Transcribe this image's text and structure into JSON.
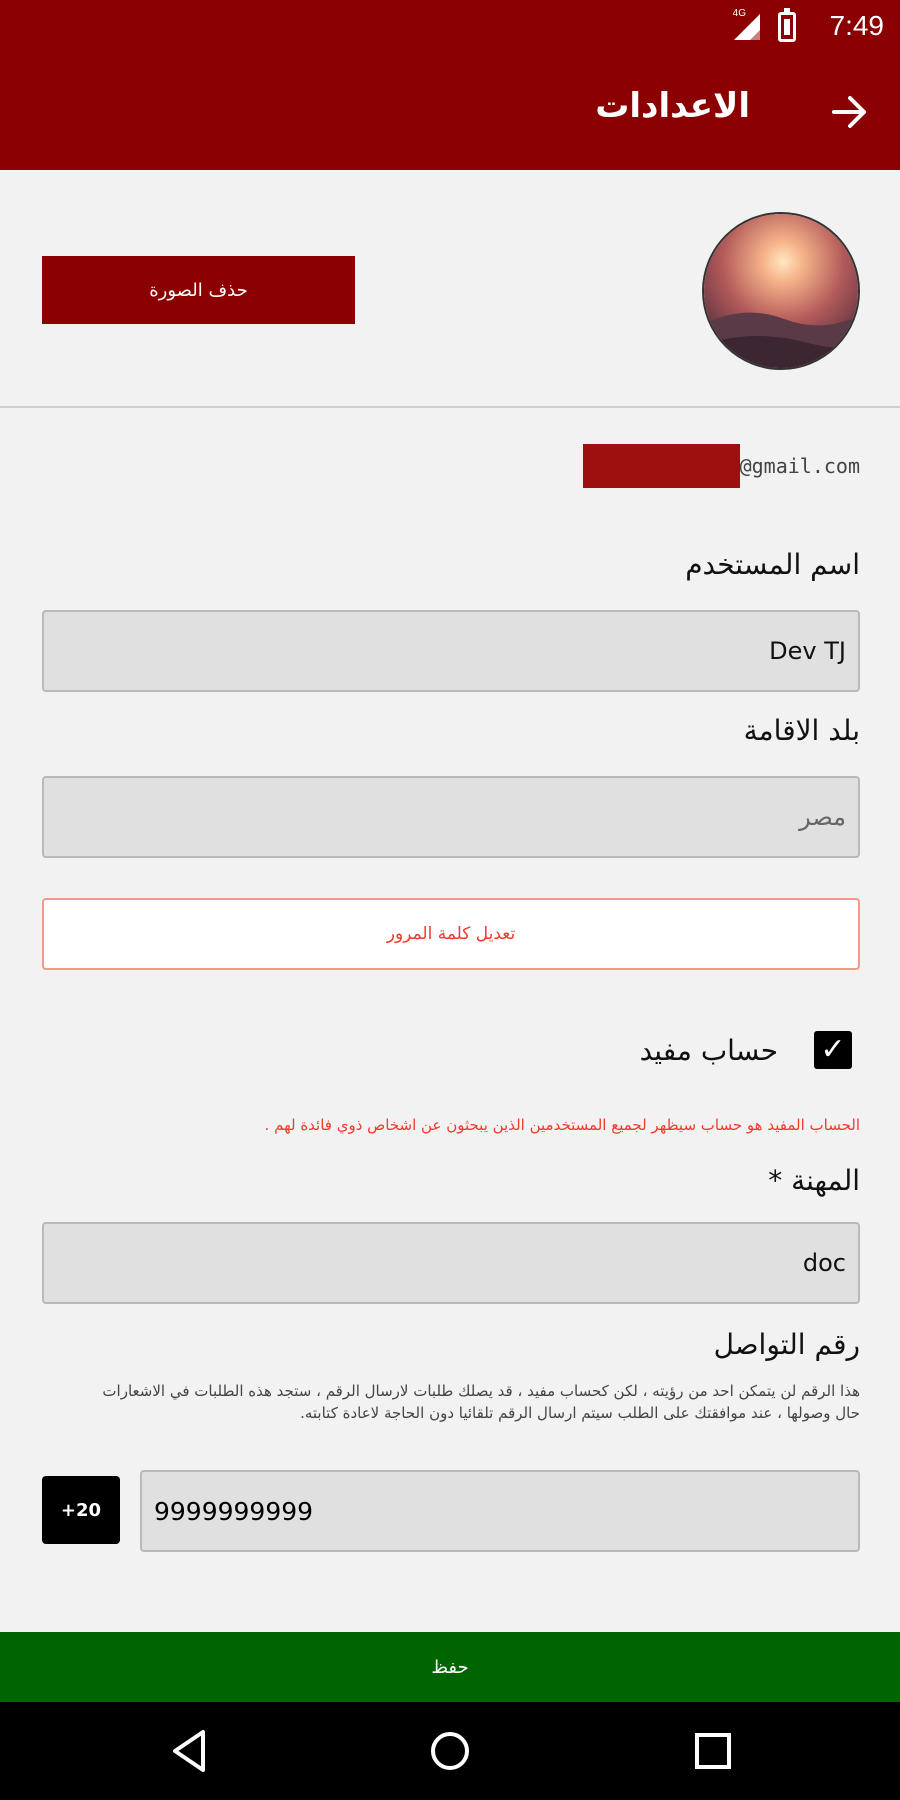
{
  "status_bar": {
    "network_label": "4G",
    "time": "7:49"
  },
  "app_bar": {
    "title": "الاعدادات",
    "back_icon": "arrow-right-icon"
  },
  "profile": {
    "delete_photo_label": "حذف الصورة"
  },
  "account": {
    "email_domain": "@gmail.com"
  },
  "username": {
    "label": "اسم المستخدم",
    "value": "Dev TJ"
  },
  "residence": {
    "label": "بلد الاقامة",
    "placeholder": "مصر"
  },
  "change_password_label": "تعديل كلمة المرور",
  "useful_account": {
    "label": "حساب مفيد",
    "checked": true,
    "note": "الحساب المفيد هو حساب سيظهر لجميع المستخدمين الذين يبحثون عن اشخاص ذوي فائدة لهم ."
  },
  "profession": {
    "label": "المهنة *",
    "value": "doc"
  },
  "contact": {
    "label": "رقم التواصل",
    "note": "هذا الرقم لن يتمكن احد من رؤيته ، لكن كحساب مفيد ، قد يصلك طلبات لارسال الرقم ، ستجد هذه الطلبات في الاشعارات حال وصولها ، عند موافقتك على الطلب سيتم ارسال الرقم تلقائيا دون الحاجة لاعادة كتابته.",
    "country_code": "+20",
    "phone": "9999999999"
  },
  "save_label": "حفظ",
  "colors": {
    "primary": "#8b0000",
    "save": "#006400",
    "alert": "#ef3b2c",
    "field_bg": "#e0e0e0"
  }
}
